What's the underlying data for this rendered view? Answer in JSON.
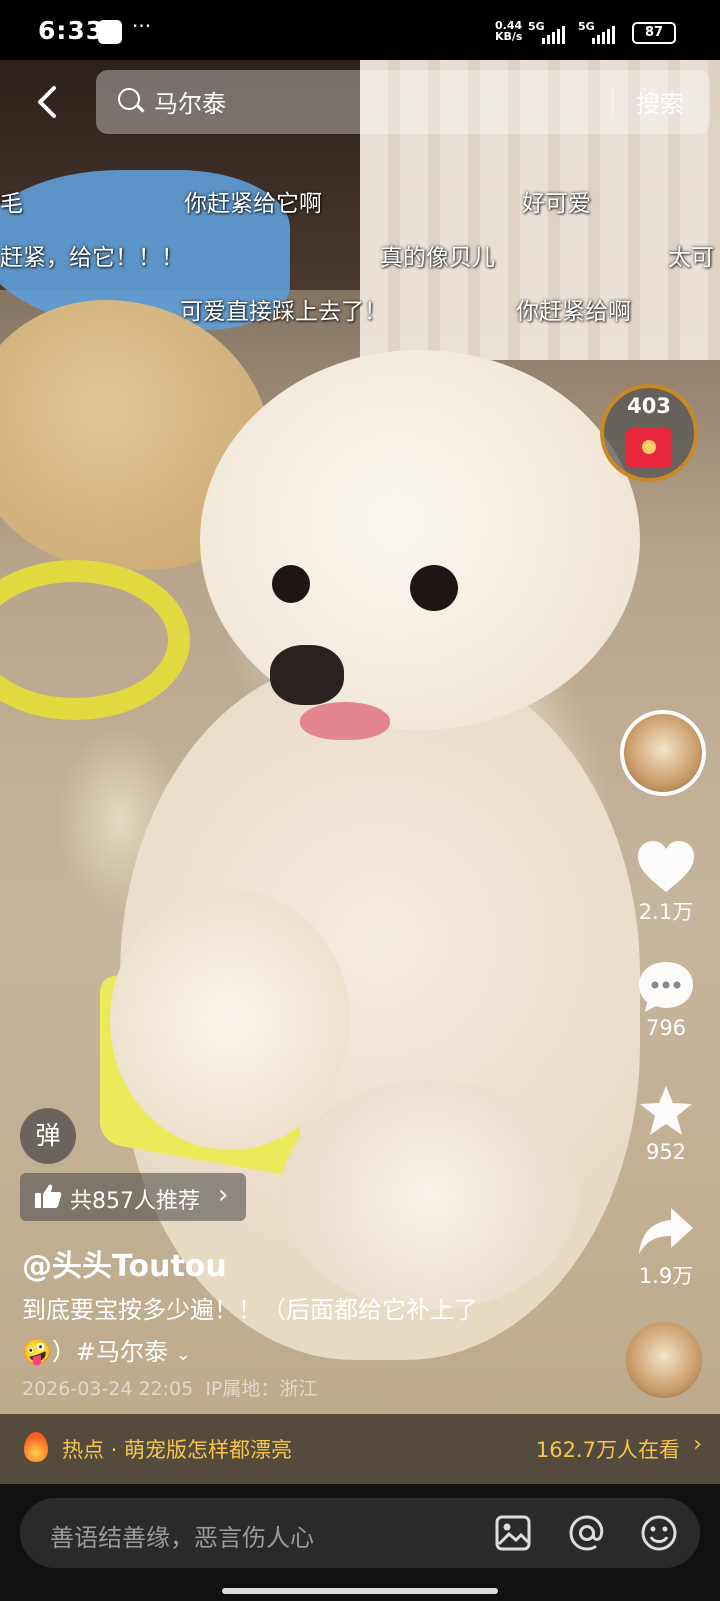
{
  "status_bar": {
    "time": "6:33",
    "dots": "···",
    "net_speed_top": "0.44",
    "net_speed_bottom": "KB/s",
    "net1": "5G",
    "net2": "5G",
    "battery": "87"
  },
  "search": {
    "query": "马尔泰",
    "button": "搜索"
  },
  "danmaku": [
    "毛",
    "你赶紧给它啊",
    "好可爱",
    "赶紧，给它！！！",
    "真的像贝儿",
    "太可",
    "可爱直接踩上去了！",
    "你赶紧给啊"
  ],
  "red_packet": {
    "count": "403"
  },
  "actions": {
    "like_count": "2.1万",
    "comment_count": "796",
    "favorite_count": "952",
    "share_count": "1.9万"
  },
  "danmu_toggle": "弹",
  "recommend": {
    "label": "共857人推荐"
  },
  "post": {
    "author": "@头头Toutou",
    "description_line1": "到底要宝按多少遍！！（后面都给它补上了",
    "emoji": "🤪",
    "description_line2": "）#马尔泰",
    "timestamp": "2026-03-24 22:05",
    "ip_location": "IP属地：浙江"
  },
  "hot": {
    "label": "热点 · 萌宠版怎样都漂亮",
    "viewers": "162.7万人在看"
  },
  "comment_input": {
    "placeholder": "善语结善缘，恶言伤人心"
  },
  "icons": [
    "back-icon",
    "search-icon",
    "heart-icon",
    "comment-icon",
    "star-icon",
    "share-icon",
    "thumb-up-icon",
    "image-icon",
    "at-icon",
    "emoji-icon",
    "fire-icon"
  ]
}
